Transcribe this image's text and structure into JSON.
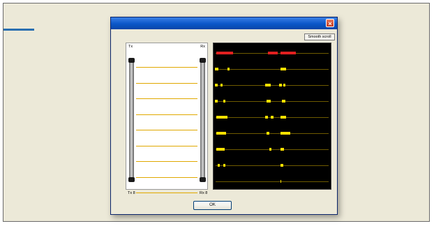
{
  "dialog": {
    "close_glyph": "×",
    "smooth_scroll_label": "Smooth scroll",
    "ok_label": "OK"
  },
  "tx_panel": {
    "top_left_label": "Tx",
    "top_right_label": "Rx",
    "bottom_left_label": "Tx 8",
    "bottom_right_label": "Rx 8",
    "beam_count": 9
  },
  "scope": {
    "channel_count": 9,
    "colors": {
      "beam": "#e0a800",
      "pulse_red": "#e02020",
      "pulse_yellow": "#ffe000",
      "background": "#000000"
    }
  }
}
